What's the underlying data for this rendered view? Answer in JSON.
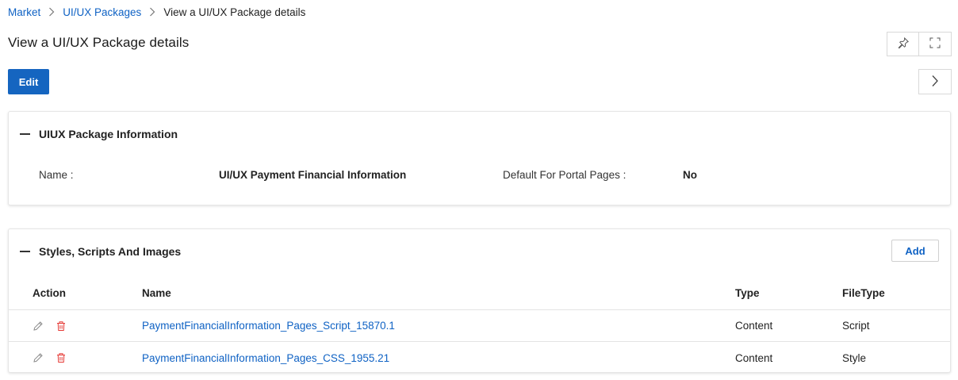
{
  "breadcrumb": {
    "items": [
      "Market",
      "UI/UX Packages"
    ],
    "current": "View a UI/UX Package details"
  },
  "page": {
    "title": "View a UI/UX Package details",
    "edit_label": "Edit"
  },
  "info_panel": {
    "title": "UIUX Package Information",
    "name_label": "Name :",
    "name_value": "UI/UX Payment Financial Information",
    "default_label": "Default For Portal Pages :",
    "default_value": "No"
  },
  "files_panel": {
    "title": "Styles, Scripts And Images",
    "add_label": "Add",
    "columns": [
      "Action",
      "Name",
      "Type",
      "FileType"
    ],
    "rows": [
      {
        "name": "PaymentFinancialInformation_Pages_Script_15870.1",
        "type": "Content",
        "filetype": "Script"
      },
      {
        "name": "PaymentFinancialInformation_Pages_CSS_1955.21",
        "type": "Content",
        "filetype": "Style"
      }
    ]
  },
  "colors": {
    "primary": "#1565c0",
    "link": "#0f62c4",
    "delete": "#e53935"
  },
  "icons": [
    "chevron-right-icon",
    "pin-icon",
    "fullscreen-icon",
    "edit-pencil-icon",
    "trash-icon"
  ]
}
